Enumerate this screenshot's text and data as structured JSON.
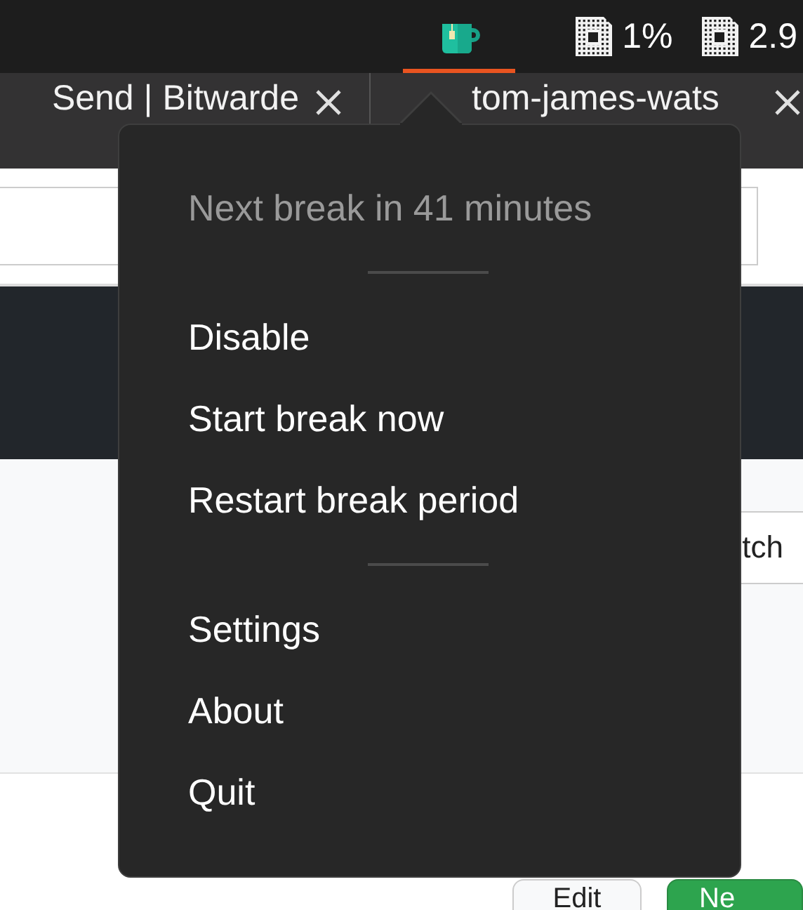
{
  "top_bar": {
    "indicators": [
      {
        "kind": "app",
        "selected": true
      },
      {
        "kind": "chip",
        "reading": "1%",
        "selected": false
      },
      {
        "kind": "chip",
        "reading": "2.9",
        "selected": false
      }
    ]
  },
  "browser": {
    "tabs": [
      {
        "label": "Send | Bitwarde"
      },
      {
        "label": "tom-james-wats"
      }
    ],
    "field_text": "tch",
    "buttons": [
      {
        "label": "Edit",
        "kind": "plain"
      },
      {
        "label": "Ne",
        "kind": "primary"
      }
    ]
  },
  "menu": {
    "groups": [
      [
        {
          "label": "Next break in 41 minutes",
          "disabled": true
        }
      ],
      [
        {
          "label": "Disable",
          "disabled": false
        },
        {
          "label": "Start break now",
          "disabled": false
        },
        {
          "label": "Restart break period",
          "disabled": false
        }
      ],
      [
        {
          "label": "Settings",
          "disabled": false
        },
        {
          "label": "About",
          "disabled": false
        },
        {
          "label": "Quit",
          "disabled": false
        }
      ]
    ]
  }
}
